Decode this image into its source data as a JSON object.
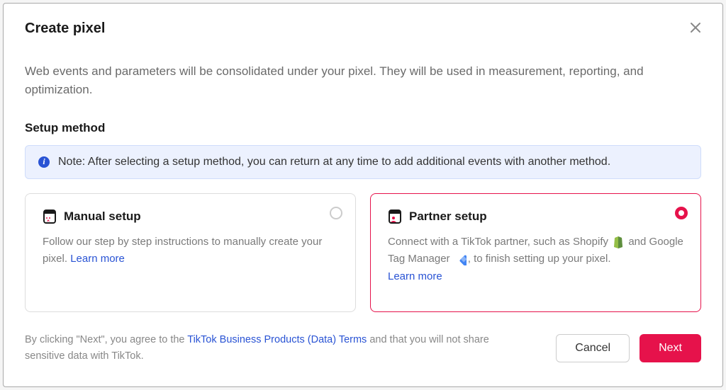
{
  "modal": {
    "title": "Create pixel",
    "description": "Web events and parameters will be consolidated under your pixel. They will be used in measurement, reporting, and optimization.",
    "section_label": "Setup method",
    "info_note": "Note: After selecting a setup method, you can return at any time to add additional events with another method."
  },
  "cards": {
    "manual": {
      "title": "Manual setup",
      "desc": "Follow our step by step instructions to manually create your pixel. ",
      "learn_more": "Learn more",
      "selected": false
    },
    "partner": {
      "title": "Partner setup",
      "desc_pre": "Connect with a TikTok partner, such as Shopify ",
      "desc_mid": " and Google Tag Manager ",
      "desc_post": ", to finish setting up your pixel. ",
      "learn_more": "Learn more",
      "selected": true
    }
  },
  "footer": {
    "text_pre": "By clicking \"Next\", you agree to the ",
    "terms_link": "TikTok Business Products (Data) Terms",
    "text_post": " and that you will not share sensitive data with TikTok.",
    "cancel": "Cancel",
    "next": "Next"
  }
}
